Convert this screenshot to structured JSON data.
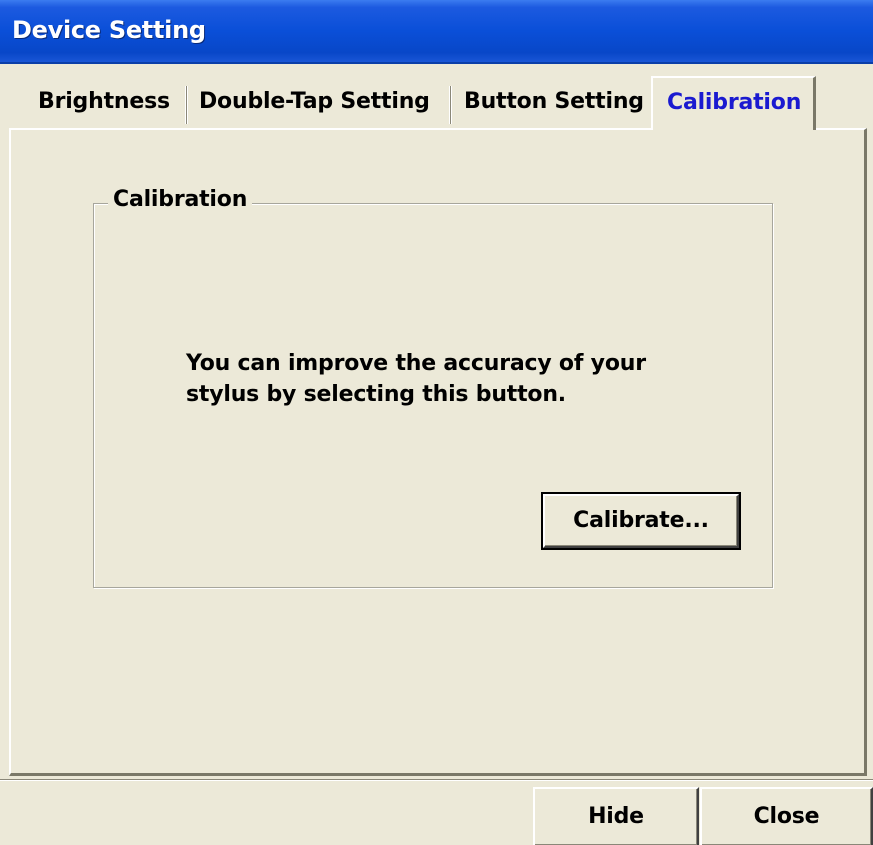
{
  "window": {
    "title": "Device Setting"
  },
  "tabs": [
    {
      "label": "Brightness",
      "active": false
    },
    {
      "label": "Double-Tap Setting",
      "active": false
    },
    {
      "label": "Button Setting",
      "active": false
    },
    {
      "label": "Calibration",
      "active": true
    }
  ],
  "calibration_group": {
    "title": "Calibration",
    "info_line_1": "You can improve the accuracy of your",
    "info_line_2": "stylus by selecting this button.",
    "calibrate_button": "Calibrate..."
  },
  "footer": {
    "hide_button": "Hide",
    "close_button": "Close"
  },
  "colors": {
    "titlebar": "#0a4fd8",
    "window_bg": "#ece9d8",
    "active_tab_text": "#1a1ad0"
  }
}
